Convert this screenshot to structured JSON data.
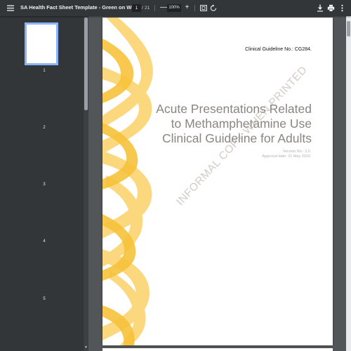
{
  "toolbar": {
    "title": "SA Health Fact Sheet Template - Green on White - Helix P...",
    "current_page": "1",
    "page_separator": "/",
    "total_pages": "21",
    "zoom_out": "—",
    "zoom_level": "100%",
    "zoom_in": "+"
  },
  "sidebar": {
    "thumbnails": [
      "1",
      "2",
      "3",
      "4",
      "5"
    ]
  },
  "document": {
    "guideline_no": "Clinical Guideline No.: CG284.",
    "title_lines": [
      "Acute Presentations Related",
      "to Methamphetamine Use",
      "Clinical Guideline for Adults"
    ],
    "version": "Version No.:  2.0",
    "approval": "Approval date:  21 May 2019",
    "watermark": "INFORMAL COPY WHEN PRINTED"
  },
  "colors": {
    "toolbar_bg": "#323639",
    "viewport_bg": "#525659",
    "helix_yellow": "#f9c94a",
    "title_gray": "#8a8580",
    "thumb_border": "#8ab4f8"
  }
}
